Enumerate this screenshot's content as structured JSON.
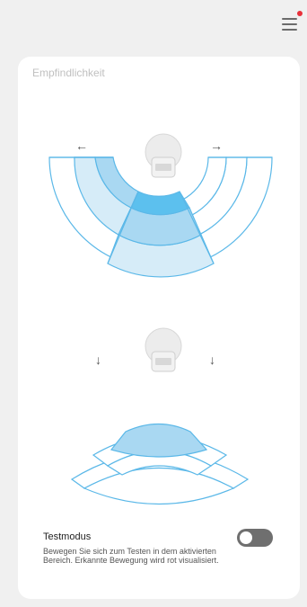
{
  "header": {
    "menu_icon": "hamburger-menu-icon",
    "has_notification": true,
    "notification_color": "#e8303a"
  },
  "sensitivity": {
    "title": "Empfindlichkeit",
    "arrow_left": "←",
    "arrow_right": "→",
    "arrow_down": "↓"
  },
  "testmode": {
    "title": "Testmodus",
    "description": "Bewegen Sie sich zum Testen in dem aktivierten Bereich. Erkannte Bewegung wird rot visualisiert.",
    "enabled": false
  },
  "colors": {
    "zone_outline": "#5bb8e8",
    "zone_fill_light": "#d6ecf8",
    "zone_fill_mid": "#a9d8f2",
    "zone_fill_active": "#5cc0ee",
    "toggle_off": "#6f6f6f"
  }
}
